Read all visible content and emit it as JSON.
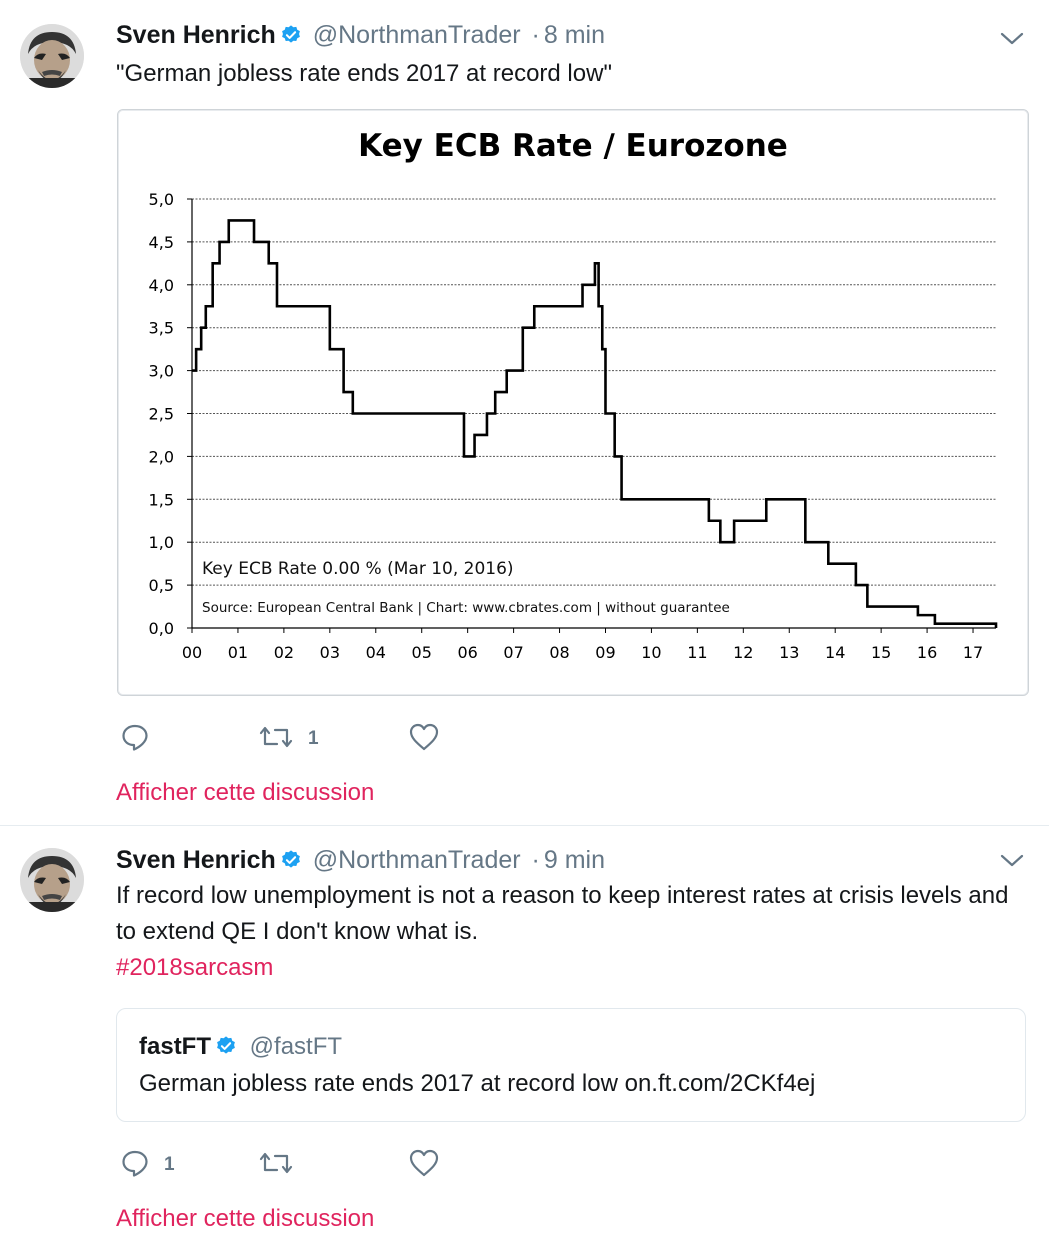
{
  "colors": {
    "link": "#e0245e",
    "muted": "#657786",
    "verified": "#1da1f2",
    "text": "#14171a"
  },
  "tweets": [
    {
      "author_name": "Sven Henrich",
      "handle": "@NorthmanTrader",
      "separator": "·",
      "time": "8 min",
      "text": "\"German jobless rate ends 2017 at record low\"",
      "actions": {
        "reply_count": "",
        "retweet_count": "1",
        "like_count": ""
      },
      "discussion_link": "Afficher cette discussion"
    },
    {
      "author_name": "Sven Henrich",
      "handle": "@NorthmanTrader",
      "separator": "·",
      "time": "9 min",
      "text": "If record low unemployment is not a reason to keep interest rates at crisis levels and to extend QE I don't know what is.",
      "hashtag": "#2018sarcasm",
      "quoted": {
        "author_name": "fastFT",
        "handle": "@fastFT",
        "text": "German jobless rate ends 2017 at record low on.ft.com/2CKf4ej"
      },
      "actions": {
        "reply_count": "1",
        "retweet_count": "",
        "like_count": ""
      },
      "discussion_link": "Afficher cette discussion"
    }
  ],
  "icons": [
    "avatar",
    "verified-badge-icon",
    "chevron-down-icon",
    "reply-icon",
    "retweet-icon",
    "like-icon"
  ],
  "chart_data": {
    "type": "line",
    "step": true,
    "title": "Key ECB Rate / Eurozone",
    "annotation": "Key ECB Rate 0.00 % (Mar 10, 2016)",
    "source": "Source: European Central Bank | Chart: www.cbrates.com | without guarantee",
    "x_ticks": [
      "00",
      "01",
      "02",
      "03",
      "04",
      "05",
      "06",
      "07",
      "08",
      "09",
      "10",
      "11",
      "12",
      "13",
      "14",
      "15",
      "16",
      "17"
    ],
    "y_ticks": [
      "0,0",
      "0,5",
      "1,0",
      "1,5",
      "2,0",
      "2,5",
      "3,0",
      "3,5",
      "4,0",
      "4,5",
      "5,0"
    ],
    "xlim": [
      2000.0,
      2017.5
    ],
    "ylim": [
      0,
      5
    ],
    "grid": true,
    "series": [
      {
        "x": [
          2000.0,
          2000.09,
          2000.2,
          2000.3,
          2000.45,
          2000.6,
          2000.8,
          2001.35,
          2001.67,
          2001.85,
          2003.0,
          2003.3,
          2003.5,
          2005.92,
          2006.15,
          2006.42,
          2006.6,
          2006.85,
          2007.2,
          2007.45,
          2008.5,
          2008.77,
          2008.85,
          2008.93,
          2009.0,
          2009.2,
          2009.35,
          2011.25,
          2011.5,
          2011.8,
          2012.5,
          2013.35,
          2013.85,
          2014.45,
          2014.7,
          2015.8,
          2016.17,
          2017.5
        ],
        "y": [
          3.0,
          3.25,
          3.5,
          3.75,
          4.25,
          4.5,
          4.75,
          4.5,
          4.25,
          3.75,
          3.25,
          2.75,
          2.5,
          2.0,
          2.25,
          2.5,
          2.75,
          3.0,
          3.5,
          3.75,
          4.0,
          4.25,
          3.75,
          3.25,
          2.5,
          2.0,
          1.5,
          1.25,
          1.0,
          1.25,
          1.5,
          1.0,
          0.75,
          0.5,
          0.25,
          0.15,
          0.05,
          0.0
        ]
      }
    ]
  }
}
